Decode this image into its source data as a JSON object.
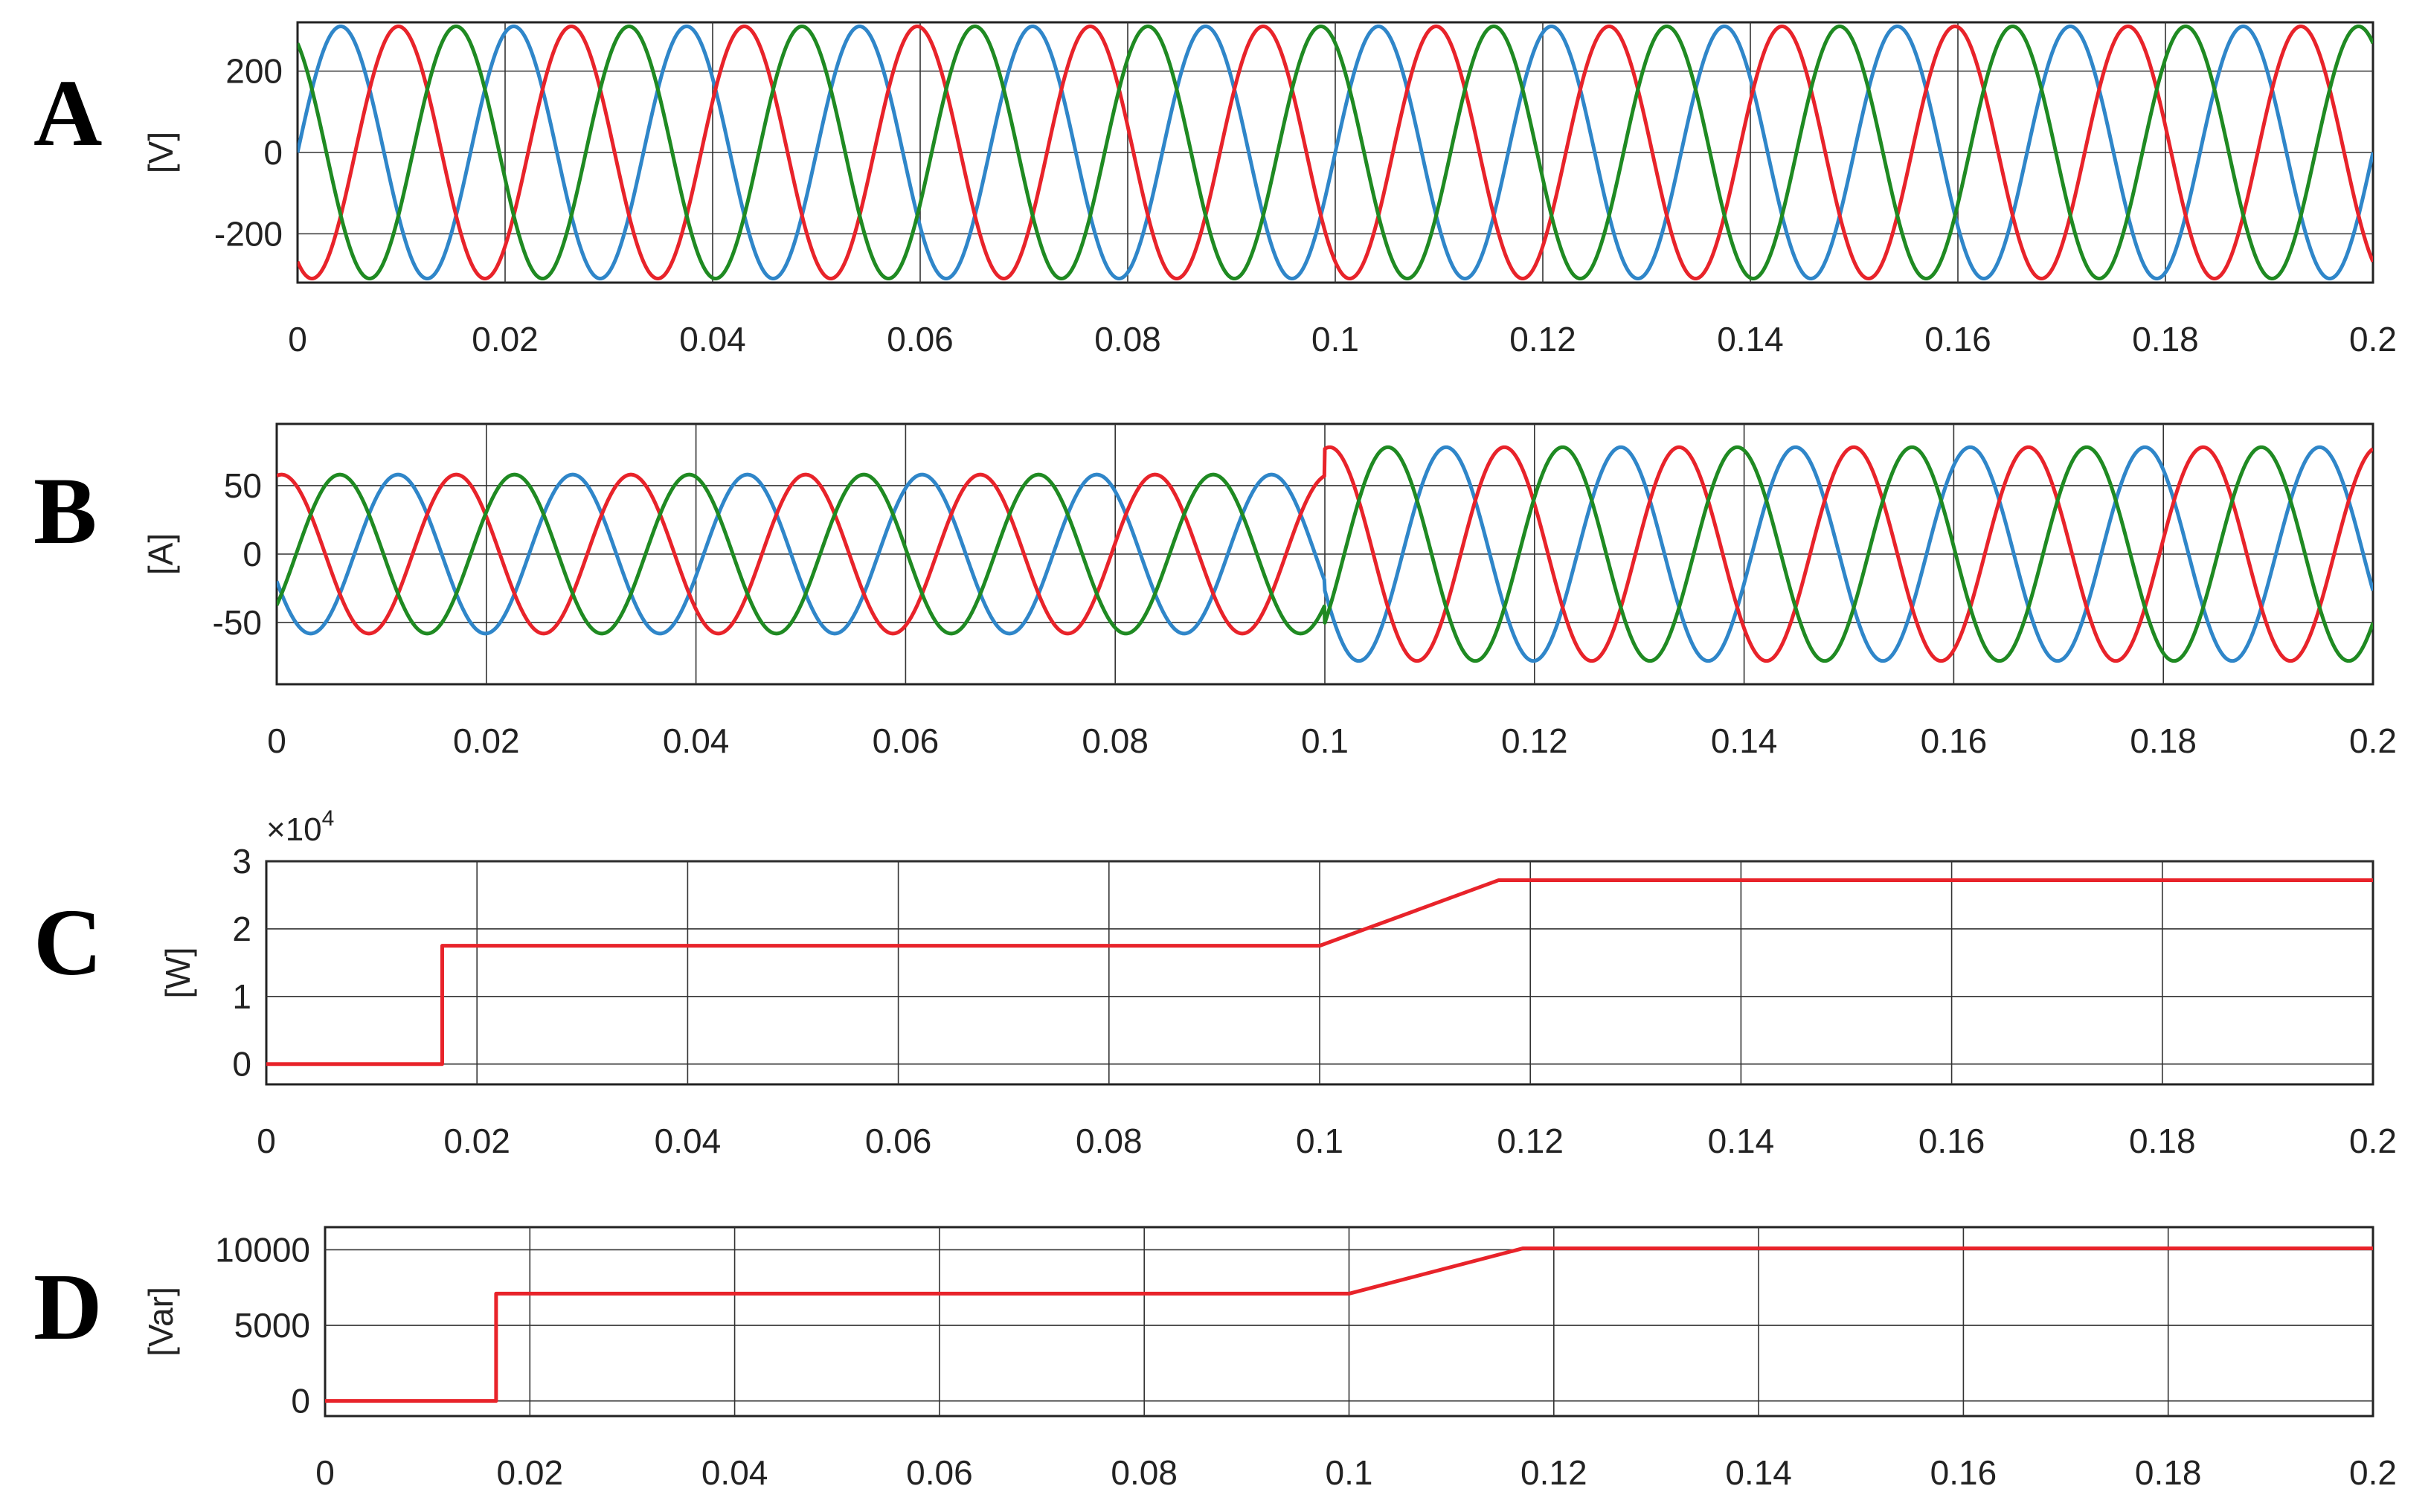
{
  "colors": {
    "phase_a": "#2f86c9",
    "phase_b": "#e8232a",
    "phase_c": "#1f8a22",
    "trace": "#e8232a"
  },
  "chart_data": [
    {
      "panel": "A",
      "type": "line",
      "ylabel": "[V]",
      "xlim": [
        0,
        0.2
      ],
      "ylim": [
        -320,
        320
      ],
      "x_ticks": [
        "0",
        "0.02",
        "0.04",
        "0.06",
        "0.08",
        "0.1",
        "0.12",
        "0.14",
        "0.16",
        "0.18",
        "0.2"
      ],
      "y_ticks": [
        {
          "value": 200,
          "label": "200"
        },
        {
          "value": 0,
          "label": "0"
        },
        {
          "value": -200,
          "label": "-200"
        }
      ],
      "grid": true,
      "series": [
        {
          "color": "#2f86c9",
          "waveform": "sine",
          "amplitude": 310,
          "frequency_hz": 60,
          "phase_deg": 0
        },
        {
          "color": "#e8232a",
          "waveform": "sine",
          "amplitude": 310,
          "frequency_hz": 60,
          "phase_deg": -120
        },
        {
          "color": "#1f8a22",
          "waveform": "sine",
          "amplitude": 310,
          "frequency_hz": 60,
          "phase_deg": 120
        }
      ]
    },
    {
      "panel": "B",
      "type": "line",
      "ylabel": "[A]",
      "xlim": [
        0,
        0.2
      ],
      "ylim": [
        -95,
        95
      ],
      "x_ticks": [
        "0",
        "0.02",
        "0.04",
        "0.06",
        "0.08",
        "0.1",
        "0.12",
        "0.14",
        "0.16",
        "0.18",
        "0.2"
      ],
      "y_ticks": [
        {
          "value": 50,
          "label": "50"
        },
        {
          "value": 0,
          "label": "0"
        },
        {
          "value": -50,
          "label": "-50"
        }
      ],
      "grid": true,
      "series": [
        {
          "color": "#2f86c9",
          "waveform": "sine",
          "frequency_hz": 60,
          "phase_deg": -160,
          "amplitude_segments": [
            {
              "x": 0,
              "amplitude": 58
            },
            {
              "x": 0.1,
              "amplitude": 58
            },
            {
              "x": 0.1,
              "amplitude": 78
            },
            {
              "x": 0.2,
              "amplitude": 78
            }
          ]
        },
        {
          "color": "#e8232a",
          "waveform": "sine",
          "frequency_hz": 60,
          "phase_deg": 80,
          "amplitude_segments": [
            {
              "x": 0,
              "amplitude": 58
            },
            {
              "x": 0.1,
              "amplitude": 58
            },
            {
              "x": 0.1,
              "amplitude": 78
            },
            {
              "x": 0.2,
              "amplitude": 78
            }
          ]
        },
        {
          "color": "#1f8a22",
          "waveform": "sine",
          "frequency_hz": 60,
          "phase_deg": -40,
          "amplitude_segments": [
            {
              "x": 0,
              "amplitude": 58
            },
            {
              "x": 0.1,
              "amplitude": 58
            },
            {
              "x": 0.1,
              "amplitude": 78
            },
            {
              "x": 0.2,
              "amplitude": 78
            }
          ]
        }
      ]
    },
    {
      "panel": "C",
      "type": "line",
      "ylabel": "[W]",
      "y_exponent": {
        "base": "×10",
        "power": "4"
      },
      "xlim": [
        0,
        0.2
      ],
      "ylim": [
        -0.3,
        3.0
      ],
      "x_ticks": [
        "0",
        "0.02",
        "0.04",
        "0.06",
        "0.08",
        "0.1",
        "0.12",
        "0.14",
        "0.16",
        "0.18",
        "0.2"
      ],
      "y_ticks": [
        {
          "value": 3,
          "label": "3"
        },
        {
          "value": 2,
          "label": "2"
        },
        {
          "value": 1,
          "label": "1"
        },
        {
          "value": 0,
          "label": "0"
        }
      ],
      "grid": true,
      "series": [
        {
          "color": "#e8232a",
          "x": [
            0,
            0.0167,
            0.0167,
            0.1,
            0.117,
            0.2
          ],
          "y": [
            0,
            0,
            1.75,
            1.75,
            2.72,
            2.72
          ]
        }
      ]
    },
    {
      "panel": "D",
      "type": "line",
      "ylabel": "[Var]",
      "xlim": [
        0,
        0.2
      ],
      "ylim": [
        -1000,
        11500
      ],
      "x_ticks": [
        "0",
        "0.02",
        "0.04",
        "0.06",
        "0.08",
        "0.1",
        "0.12",
        "0.14",
        "0.16",
        "0.18",
        "0.2"
      ],
      "y_ticks": [
        {
          "value": 10000,
          "label": "10000"
        },
        {
          "value": 5000,
          "label": "5000"
        },
        {
          "value": 0,
          "label": "0"
        }
      ],
      "grid": true,
      "series": [
        {
          "color": "#e8232a",
          "x": [
            0,
            0.0167,
            0.0167,
            0.1,
            0.117,
            0.2
          ],
          "y": [
            0,
            0,
            7100,
            7100,
            10100,
            10100
          ]
        }
      ]
    }
  ]
}
